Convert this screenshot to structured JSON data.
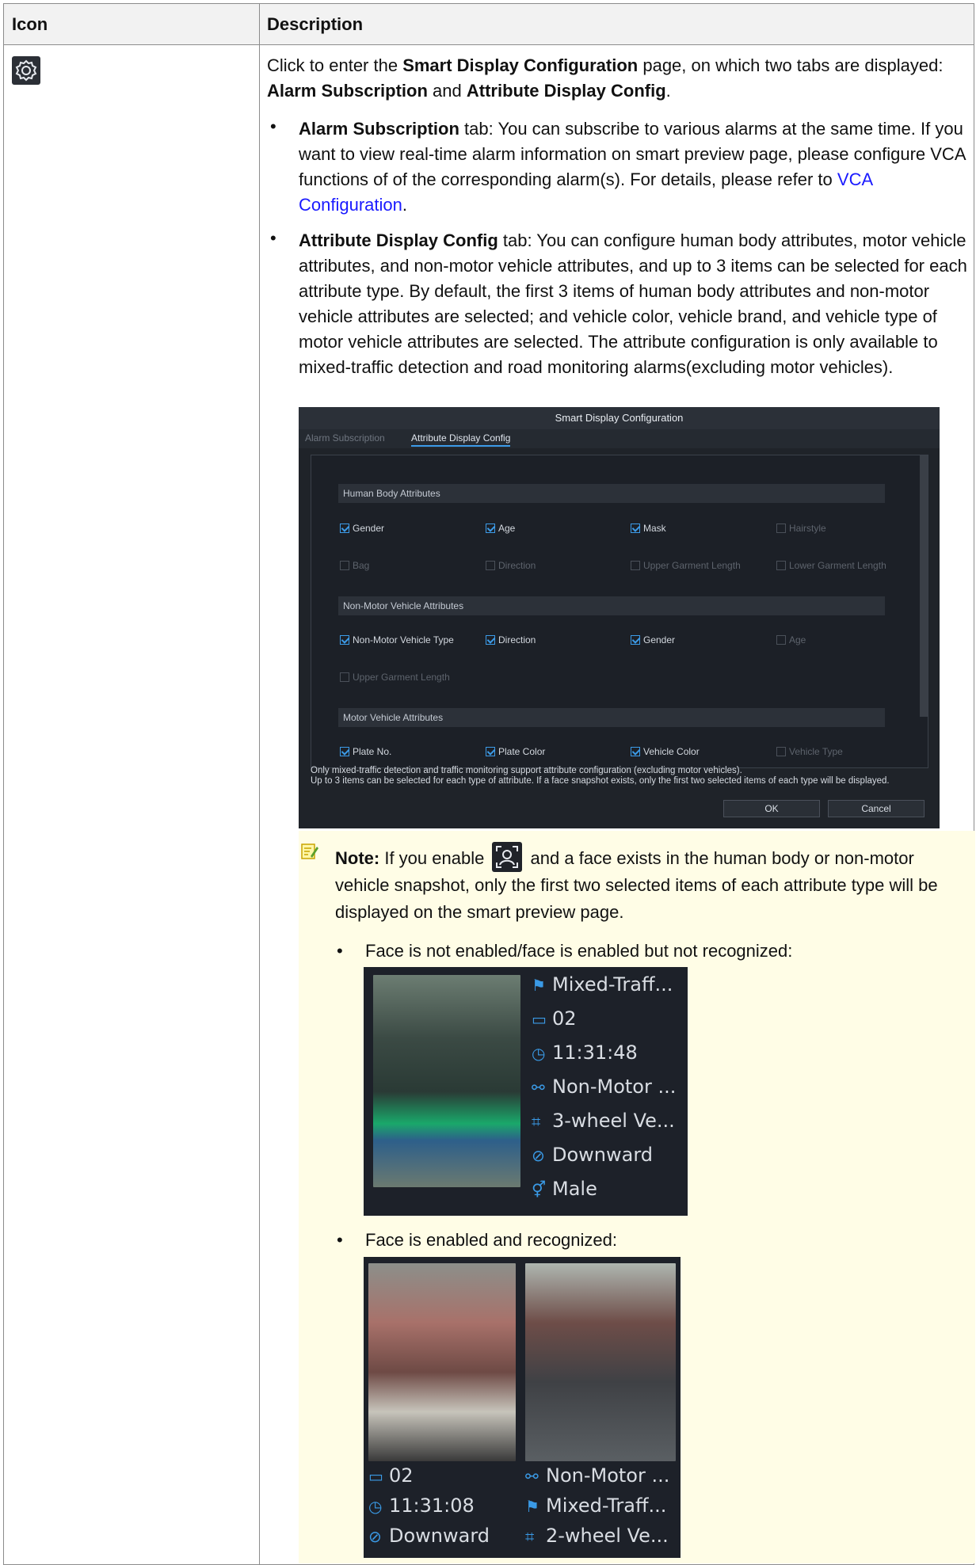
{
  "table": {
    "header_icon": "Icon",
    "header_description": "Description"
  },
  "row": {
    "icon": "gear-icon",
    "intro_pre": "Click to enter the ",
    "intro_page": "Smart Display Configuration",
    "intro_mid": " page, on which two tabs are displayed: ",
    "intro_tab1": "Alarm Subscription",
    "intro_and": " and ",
    "intro_tab2": "Attribute Display Config",
    "intro_end": ".",
    "bullet1_bold": "Alarm Subscription",
    "bullet1_text": " tab: You can subscribe to various alarms at the same time. If you want to view real-time alarm information on smart preview page, please configure VCA functions of of the corresponding alarm(s). For details, please refer to ",
    "bullet1_link": "VCA Configuration",
    "bullet1_end": ".",
    "bullet2_bold": "Attribute Display Config",
    "bullet2_text": " tab: You can configure human body attributes, motor vehicle attributes, and non-motor vehicle attributes, and up to 3 items can be selected for each attribute type. By default, the first 3 items of human body attributes and non-motor vehicle attributes are selected; and vehicle color, vehicle brand, and vehicle type of motor vehicle attributes are selected. The attribute configuration is only available to mixed-traffic detection and road monitoring alarms(excluding motor vehicles)."
  },
  "dialog": {
    "title": "Smart Display Configuration",
    "tab_subscription": "Alarm Subscription",
    "tab_attribute": "Attribute Display Config",
    "sections": {
      "human": "Human Body Attributes",
      "nonmotor": "Non-Motor Vehicle Attributes",
      "motor": "Motor Vehicle Attributes"
    },
    "human_items": [
      {
        "label": "Gender",
        "checked": true
      },
      {
        "label": "Age",
        "checked": true
      },
      {
        "label": "Mask",
        "checked": true
      },
      {
        "label": "Hairstyle",
        "checked": false
      },
      {
        "label": "Bag",
        "checked": false
      },
      {
        "label": "Direction",
        "checked": false
      },
      {
        "label": "Upper Garment Length",
        "checked": false
      },
      {
        "label": "Lower Garment Length",
        "checked": false
      }
    ],
    "nonmotor_items": [
      {
        "label": "Non-Motor Vehicle Type",
        "checked": true
      },
      {
        "label": "Direction",
        "checked": true
      },
      {
        "label": "Gender",
        "checked": true
      },
      {
        "label": "Age",
        "checked": false
      },
      {
        "label": "Upper Garment Length",
        "checked": false
      }
    ],
    "motor_items": [
      {
        "label": "Plate No.",
        "checked": true
      },
      {
        "label": "Plate Color",
        "checked": true
      },
      {
        "label": "Vehicle Color",
        "checked": true
      },
      {
        "label": "Vehicle Type",
        "checked": false
      }
    ],
    "note_line1": "Only mixed-traffic detection and traffic monitoring support attribute configuration (excluding motor vehicles).",
    "note_line2": "Up to 3 items can be selected for each type of attribute. If a face snapshot exists, only the first two selected items of each type will be displayed.",
    "ok": "OK",
    "cancel": "Cancel"
  },
  "note": {
    "label": "Note:",
    "text_pre": " If you enable ",
    "face_icon": "face-recognition-icon",
    "text_post": " and a face exists in the human body or non-motor vehicle snapshot, only the first two selected items of each attribute type will be displayed on the smart preview page.",
    "case1": "Face is not enabled/face is enabled but not recognized:",
    "case2": "Face is enabled and recognized:"
  },
  "snapshot1": {
    "lines": [
      "Mixed-Traff...",
      "02",
      "11:31:48",
      "Non-Motor ...",
      "3-wheel Ve...",
      "Downward",
      "Male"
    ]
  },
  "snapshot2": {
    "left_lines": [
      "02",
      "11:31:08",
      "Downward"
    ],
    "right_lines": [
      "Non-Motor ...",
      "Mixed-Traff...",
      "2-wheel Ve..."
    ]
  }
}
